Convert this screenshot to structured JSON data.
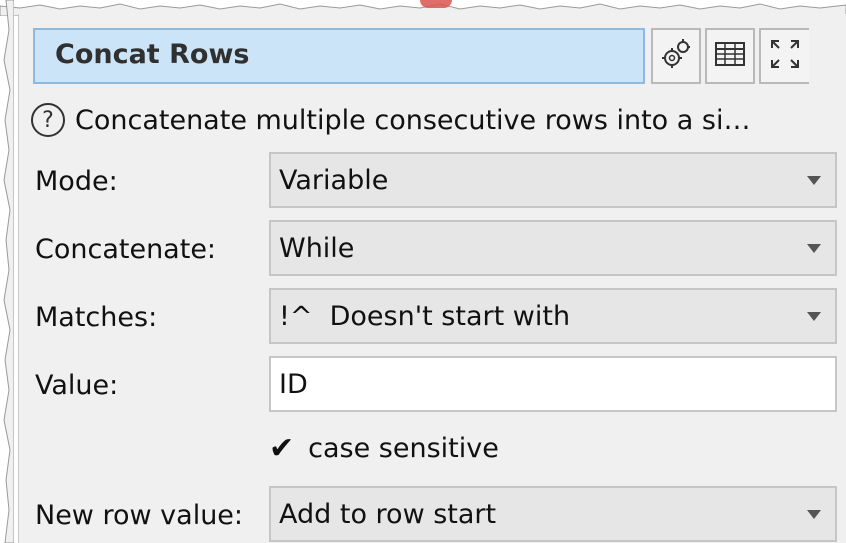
{
  "panel": {
    "title": "Concat Rows",
    "description": "Concatenate multiple consecutive rows into a si…",
    "toolbar": {
      "settings_icon": "gears-icon",
      "table_icon": "table-icon",
      "maximize_icon": "expand-icon"
    }
  },
  "form": {
    "mode": {
      "label": "Mode:",
      "value": "Variable"
    },
    "concatenate": {
      "label": "Concatenate:",
      "value": "While"
    },
    "matches": {
      "label": "Matches:",
      "value": "!^  Doesn't start with"
    },
    "value": {
      "label": "Value:",
      "value": "ID"
    },
    "case_sensitive": {
      "label": "case sensitive",
      "checked": true
    },
    "new_row_value": {
      "label": "New row value:",
      "value": "Add to row start"
    }
  },
  "colors": {
    "title_bg": "#cce4f7",
    "title_border": "#8fb8dc",
    "panel_bg": "#f0f0f0",
    "combo_bg": "#e6e6e6"
  }
}
